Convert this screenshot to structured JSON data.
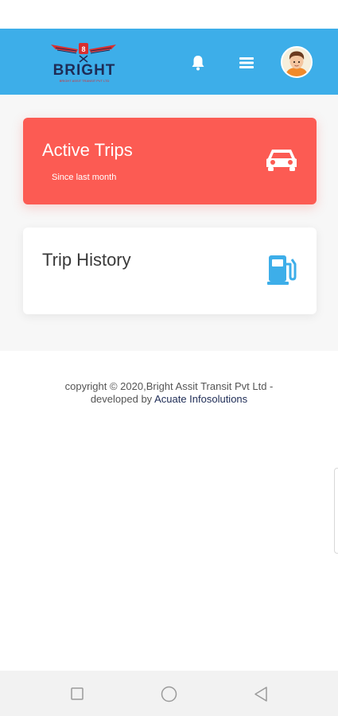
{
  "header": {
    "logo_text": "BRIGHT",
    "logo_subtitle": "BRIGHT ASSIT TRANSIT PVT LTD",
    "bar_color": "#3daee9",
    "icons": [
      "bell-icon",
      "menu-icon",
      "avatar"
    ]
  },
  "cards": {
    "active": {
      "title": "Active Trips",
      "subtitle": "Since last month",
      "icon": "car-icon",
      "color": "#fc5b53"
    },
    "history": {
      "title": "Trip History",
      "icon": "fuel-pump-icon",
      "icon_color": "#3daee9"
    }
  },
  "footer": {
    "copyright": "copyright © 2020,Bright Assit Transit Pvt Ltd -",
    "developed_by": "developed by",
    "developer": "Acuate Infosolutions"
  },
  "system_nav": {
    "buttons": [
      "recents-button",
      "home-button",
      "back-button"
    ]
  }
}
